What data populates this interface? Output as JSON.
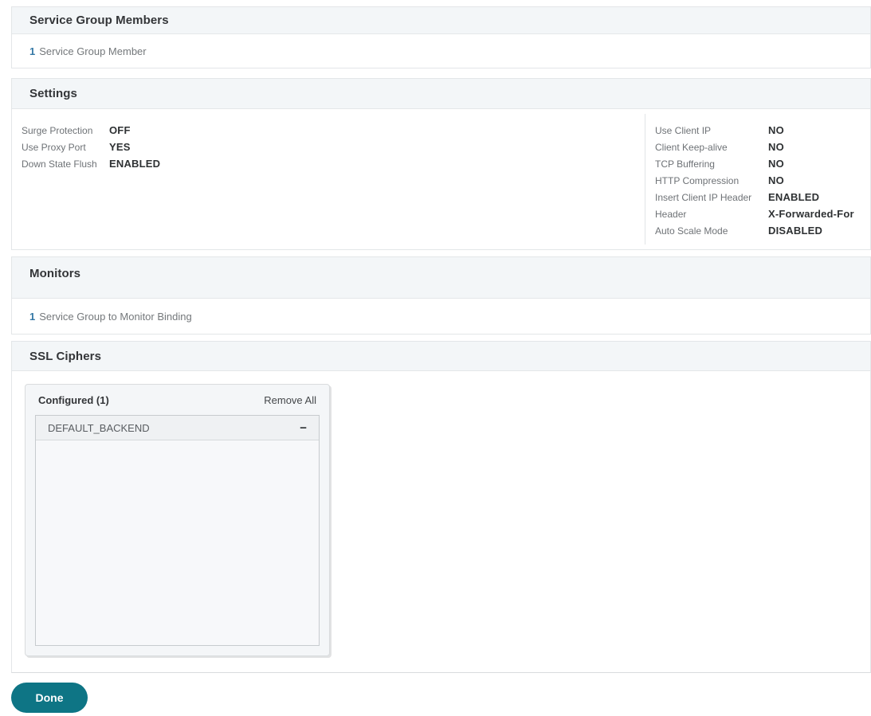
{
  "colors": {
    "accent_teal": "#0e7585",
    "link_blue": "#3578a6",
    "header_bg": "#f3f6f8",
    "panel_border": "#e3e6e8"
  },
  "sections": {
    "service_group_members": {
      "title": "Service Group Members",
      "binding_count": "1",
      "binding_label": "Service Group Member"
    },
    "settings": {
      "title": "Settings",
      "left": [
        {
          "label": "Surge Protection",
          "value": "OFF"
        },
        {
          "label": "Use Proxy Port",
          "value": "YES"
        },
        {
          "label": "Down State Flush",
          "value": "ENABLED"
        }
      ],
      "right": [
        {
          "label": "Use Client IP",
          "value": "NO"
        },
        {
          "label": "Client Keep-alive",
          "value": "NO"
        },
        {
          "label": "TCP Buffering",
          "value": "NO"
        },
        {
          "label": "HTTP Compression",
          "value": "NO"
        },
        {
          "label": "Insert Client IP Header",
          "value": "ENABLED"
        },
        {
          "label": "Header",
          "value": "X-Forwarded-For"
        },
        {
          "label": "Auto Scale Mode",
          "value": "DISABLED"
        }
      ]
    },
    "monitors": {
      "title": "Monitors",
      "binding_count": "1",
      "binding_label": "Service Group to Monitor Binding"
    },
    "ssl_ciphers": {
      "title": "SSL Ciphers",
      "configured_label": "Configured (1)",
      "remove_all_label": "Remove All",
      "ciphers": [
        {
          "name": "DEFAULT_BACKEND",
          "remove_icon": "minus-icon",
          "remove_glyph": "−"
        }
      ]
    }
  },
  "footer": {
    "done_label": "Done"
  }
}
